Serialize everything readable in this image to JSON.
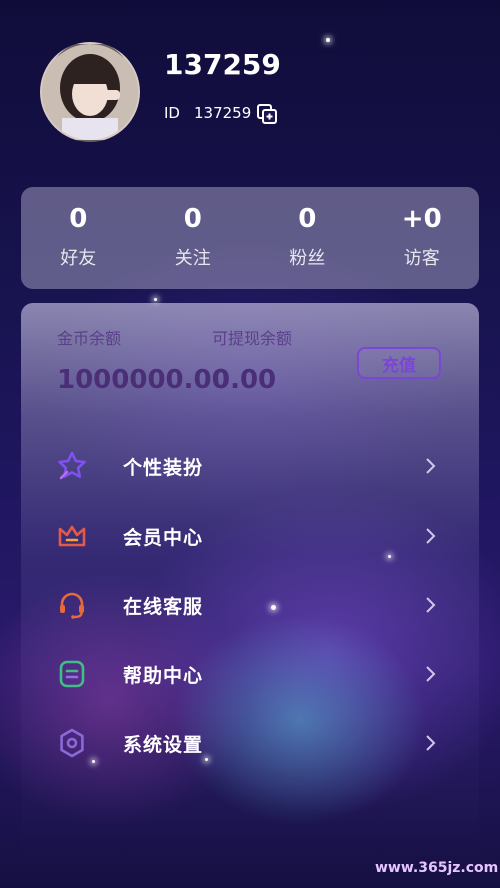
{
  "profile": {
    "username": "137259",
    "id_label": "ID",
    "id_value": "137259"
  },
  "stats": [
    {
      "value": "0",
      "label": "好友"
    },
    {
      "value": "0",
      "label": "关注"
    },
    {
      "value": "0",
      "label": "粉丝"
    },
    {
      "value": "+0",
      "label": "访客"
    }
  ],
  "wallet": {
    "coin_title": "金币余额",
    "coin_value": "1000000.00",
    "withdraw_title": "可提现余额",
    "withdraw_value": "0.00",
    "recharge_label": "充值"
  },
  "menu": [
    {
      "label": "个性装扮",
      "icon": "star-icon",
      "color": "#7d52f0"
    },
    {
      "label": "会员中心",
      "icon": "crown-icon",
      "color": "#e35a4a"
    },
    {
      "label": "在线客服",
      "icon": "headset-icon",
      "color": "#e86a3a"
    },
    {
      "label": "帮助中心",
      "icon": "help-doc-icon",
      "color": "#3fbf86"
    },
    {
      "label": "系统设置",
      "icon": "gear-icon",
      "color": "#8a6ad8"
    }
  ],
  "watermark": "www.365jz.com"
}
